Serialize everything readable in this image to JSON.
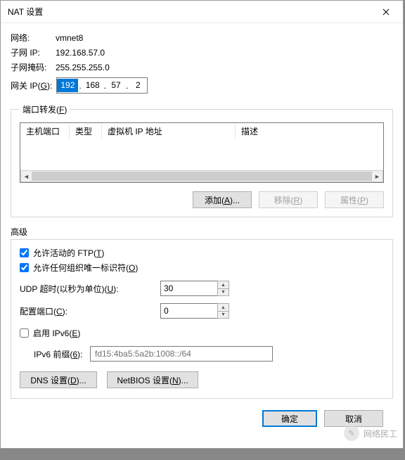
{
  "title": "NAT 设置",
  "info": {
    "network_label": "网络:",
    "network_value": "vmnet8",
    "subnet_ip_label": "子网 IP:",
    "subnet_ip_value": "192.168.57.0",
    "subnet_mask_label": "子网掩码:",
    "subnet_mask_value": "255.255.255.0"
  },
  "gateway": {
    "label": "网关 IP(G):",
    "seg1": "192",
    "seg2": "168",
    "seg3": "57",
    "seg4": "2"
  },
  "port_forward": {
    "legend": "端口转发(F)",
    "columns": {
      "host_port": "主机端口",
      "type": "类型",
      "vm_ip": "虚拟机 IP 地址",
      "desc": "描述"
    },
    "buttons": {
      "add": "添加(A)...",
      "remove": "移除(R)",
      "properties": "属性(P)"
    }
  },
  "advanced": {
    "label": "高级",
    "allow_ftp": "允许活动的 FTP(T)",
    "allow_oui": "允许任何组织唯一标识符(O)",
    "udp_timeout_label": "UDP 超时(以秒为单位)(U):",
    "udp_timeout_value": "30",
    "config_port_label": "配置端口(C):",
    "config_port_value": "0",
    "enable_ipv6": "启用 IPv6(E)",
    "ipv6_prefix_label": "IPv6 前缀(6):",
    "ipv6_prefix_value": "fd15:4ba5:5a2b:1008::/64",
    "dns_btn": "DNS 设置(D)...",
    "netbios_btn": "NetBIOS 设置(N)..."
  },
  "footer": {
    "ok": "确定",
    "cancel": "取消"
  },
  "watermark": "网络民工"
}
